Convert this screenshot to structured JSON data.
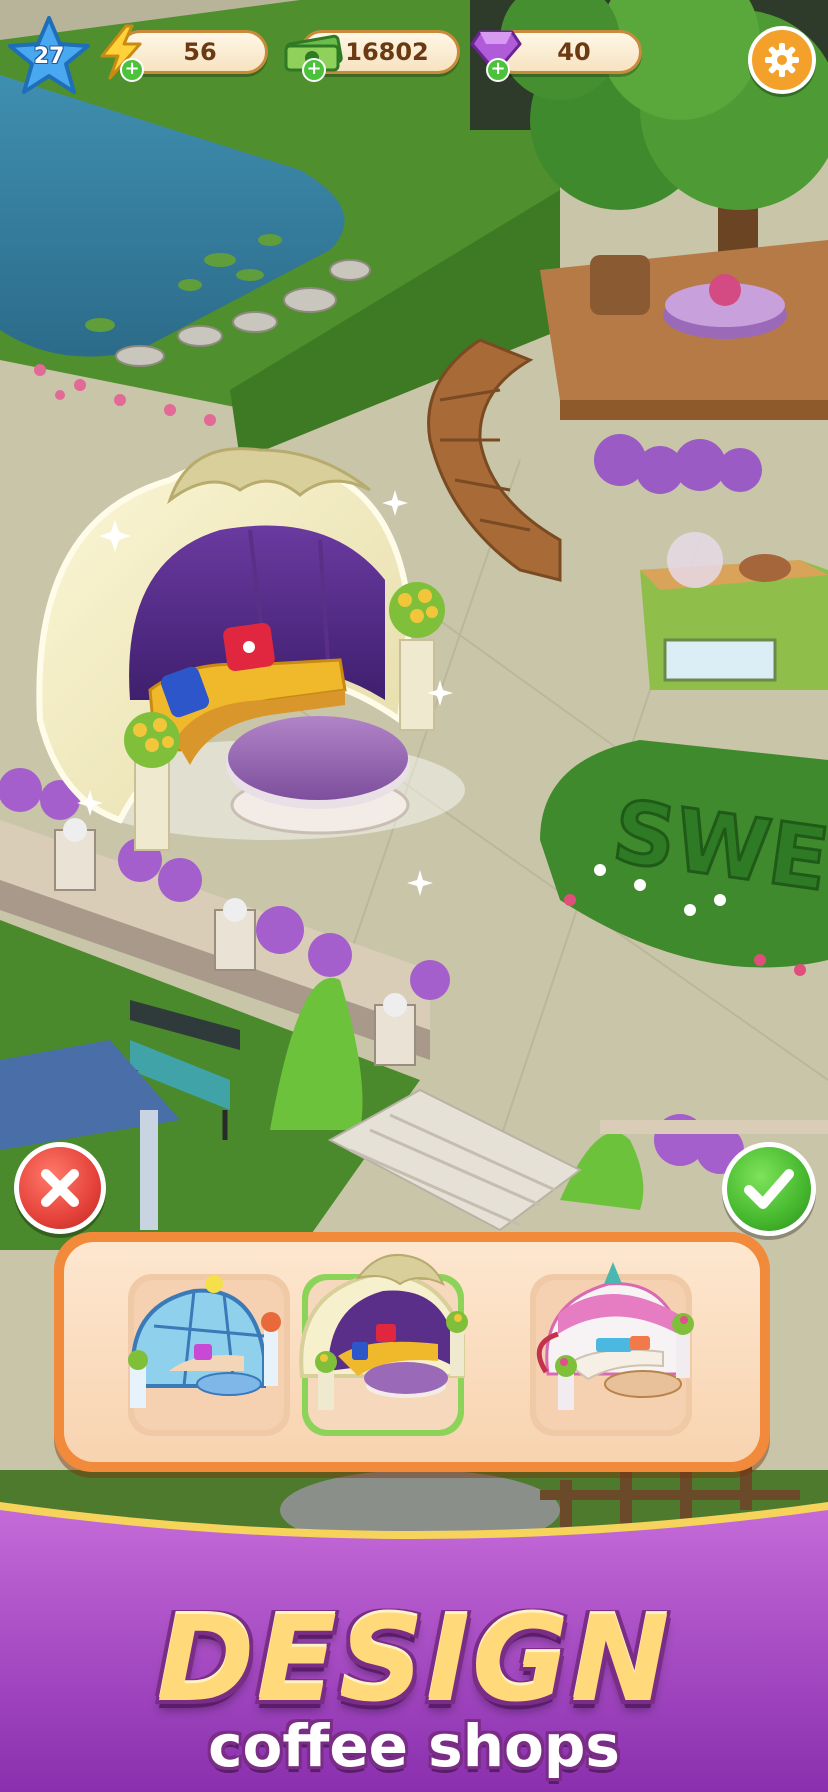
{
  "hud": {
    "level": "27",
    "energy": "56",
    "cash": "16802",
    "gems": "40",
    "plus_symbol": "+",
    "icons": {
      "level": "star-icon",
      "energy": "lightning-bolt-icon",
      "cash": "cash-stack-icon",
      "gems": "purple-gem-icon",
      "settings": "gear-icon"
    }
  },
  "scene": {
    "sign_text": "SWEE"
  },
  "actions": {
    "cancel_icon": "x-icon",
    "confirm_icon": "checkmark-icon"
  },
  "design_options": [
    {
      "name": "blue-glass-dome-lounge",
      "selected": false
    },
    {
      "name": "cream-arch-purple-lounge",
      "selected": true
    },
    {
      "name": "pink-canopy-lounge",
      "selected": false
    }
  ],
  "banner": {
    "title": "DESIGN",
    "subtitle": "coffee shops"
  },
  "colors": {
    "banner_purple": "#9a3fb8",
    "panel_orange": "#f28a3c",
    "selected_green": "#8cd35a",
    "cancel_red": "#e5423a",
    "confirm_green": "#46b82e",
    "title_gold": "#ffd97a"
  }
}
